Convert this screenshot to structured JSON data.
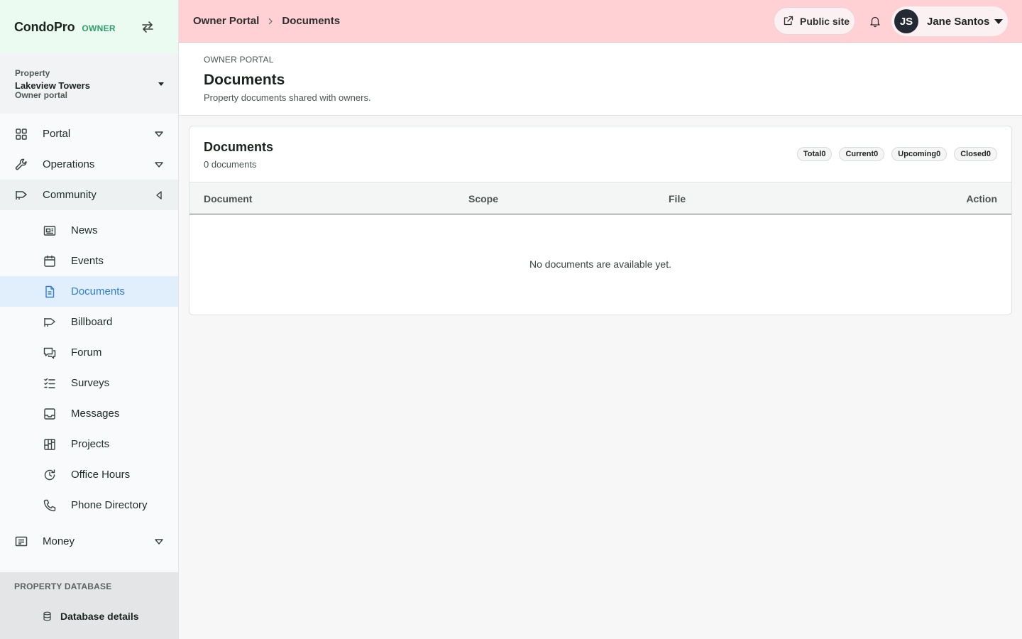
{
  "brand": {
    "name": "CondoPro",
    "role": "OWNER"
  },
  "property": {
    "label": "Property",
    "name": "Lakeview Towers",
    "subtitle": "Owner portal"
  },
  "nav": {
    "portal": "Portal",
    "operations": "Operations",
    "community": "Community",
    "community_items": [
      "News",
      "Events",
      "Documents",
      "Billboard",
      "Forum",
      "Surveys",
      "Messages",
      "Projects",
      "Office Hours",
      "Phone Directory"
    ],
    "money": "Money",
    "active_item": "Documents"
  },
  "property_database": {
    "title": "PROPERTY DATABASE",
    "item": "Database details"
  },
  "topbar": {
    "breadcrumb": [
      "Owner Portal",
      "Documents"
    ],
    "public_site": "Public site",
    "user": {
      "initials": "JS",
      "name": "Jane Santos"
    }
  },
  "page": {
    "eyebrow": "OWNER PORTAL",
    "title": "Documents",
    "description": "Property documents shared with owners."
  },
  "card": {
    "title": "Documents",
    "count": "0 documents",
    "chips": [
      "Total0",
      "Current0",
      "Upcoming0",
      "Closed0"
    ],
    "columns": [
      "Document",
      "Scope",
      "File",
      "Action"
    ],
    "empty_message": "No documents are available yet."
  },
  "colors": {
    "accent": "#2f7fd6",
    "topbar": "#ffd0d4",
    "brand_bg": "#ecfbf2",
    "role": "#2e9e6a"
  }
}
